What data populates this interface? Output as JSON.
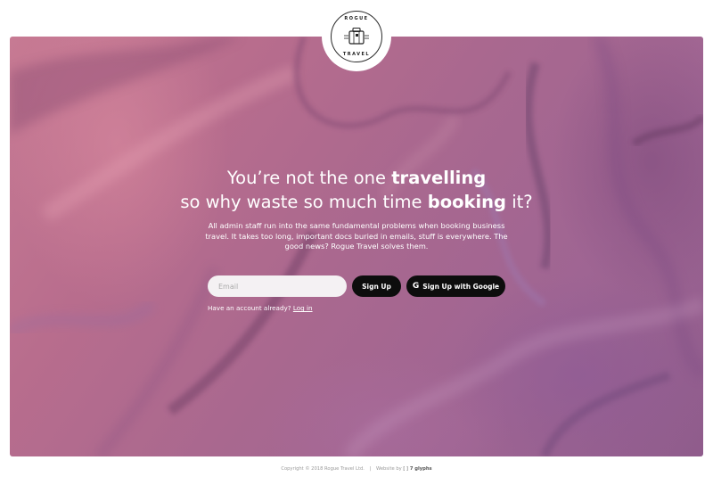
{
  "logo": {
    "top_text": "ROGUE",
    "bottom_text": "TRAVEL"
  },
  "hero": {
    "headline_line1_prefix": "You’re not the one ",
    "headline_line1_bold": "travelling",
    "headline_line2_prefix": "so why waste so much time ",
    "headline_line2_bold": "booking",
    "headline_line2_suffix": " it?",
    "subtext": "All admin staff run into the same fundamental problems when booking business travel. It takes too long, important docs buried in emails, stuff is everywhere. The good news? Rogue Travel solves them."
  },
  "form": {
    "email_placeholder": "Email",
    "email_value": "",
    "signup_label": "Sign Up",
    "google_label": "Sign Up with Google",
    "google_icon": "G",
    "login_prompt": "Have an account already? ",
    "login_link": "Log in"
  },
  "footer": {
    "copyright": "Copyright © 2018 Rogue Travel Ltd.",
    "separator": "|",
    "website_by": "Website by",
    "glyph_icon": "[ ]",
    "agency": "7 glyphs"
  },
  "colors": {
    "hero_base": "#b06b8e",
    "button_bg": "#0d0d0d",
    "input_bg": "#f4f1f3",
    "text_on_hero": "#ffffff"
  }
}
